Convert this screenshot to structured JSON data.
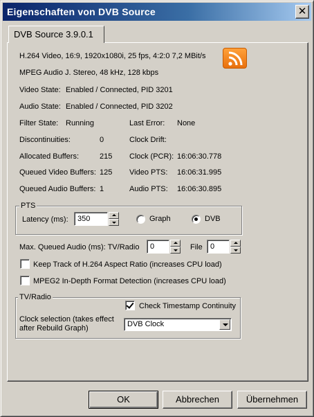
{
  "window": {
    "title": "Eigenschaften von DVB Source",
    "close_label": "✕"
  },
  "tab": {
    "label": "DVB Source 3.9.0.1"
  },
  "info": {
    "video_line": "H.264 Video, 16:9, 1920x1080i, 25 fps, 4:2:0  7,2 MBit/s",
    "audio_line": "MPEG Audio J. Stereo, 48 kHz, 128 kbps",
    "video_state_label": "Video State:",
    "video_state_value": "Enabled / Connected, PID 3201",
    "audio_state_label": "Audio State:",
    "audio_state_value": "Enabled / Connected, PID 3202",
    "icon": "rss-feed-icon"
  },
  "stats": {
    "filter_state_label": "Filter State:",
    "filter_state_value": "Running",
    "last_error_label": "Last Error:",
    "last_error_value": "None",
    "discontinuities_label": "Discontinuities:",
    "discontinuities_value": "0",
    "clock_drift_label": "Clock Drift:",
    "clock_drift_value": "",
    "allocated_buffers_label": "Allocated Buffers:",
    "allocated_buffers_value": "215",
    "clock_pcr_label": "Clock (PCR):",
    "clock_pcr_value": "16:06:30.778",
    "queued_video_label": "Queued Video Buffers:",
    "queued_video_value": "125",
    "video_pts_label": "Video PTS:",
    "video_pts_value": "16:06:31.995",
    "queued_audio_label": "Queued Audio Buffers:",
    "queued_audio_value": "1",
    "audio_pts_label": "Audio PTS:",
    "audio_pts_value": "16:06:30.895"
  },
  "pts": {
    "group_label": "PTS",
    "latency_label": "Latency (ms):",
    "latency_value": "350",
    "radio_graph_label": "Graph",
    "radio_dvb_label": "DVB",
    "selected": "DVB"
  },
  "queue": {
    "label": "Max. Queued Audio (ms): TV/Radio",
    "tvradio_value": "0",
    "file_label": "File",
    "file_value": "0"
  },
  "options": {
    "keep_track_label": "Keep Track of H.264 Aspect Ratio (increases CPU load)",
    "keep_track_checked": false,
    "mpeg2_label": "MPEG2 In-Depth Format Detection (increases CPU load)",
    "mpeg2_checked": false
  },
  "tvradio": {
    "group_label": "TV/Radio",
    "check_timestamp_label": "Check Timestamp Continuity",
    "check_timestamp_checked": true,
    "clock_selection_label_1": "Clock selection (takes effect",
    "clock_selection_label_2": "after Rebuild Graph)",
    "clock_value": "DVB Clock"
  },
  "buttons": {
    "ok": "OK",
    "cancel": "Abbrechen",
    "apply": "Übernehmen"
  }
}
